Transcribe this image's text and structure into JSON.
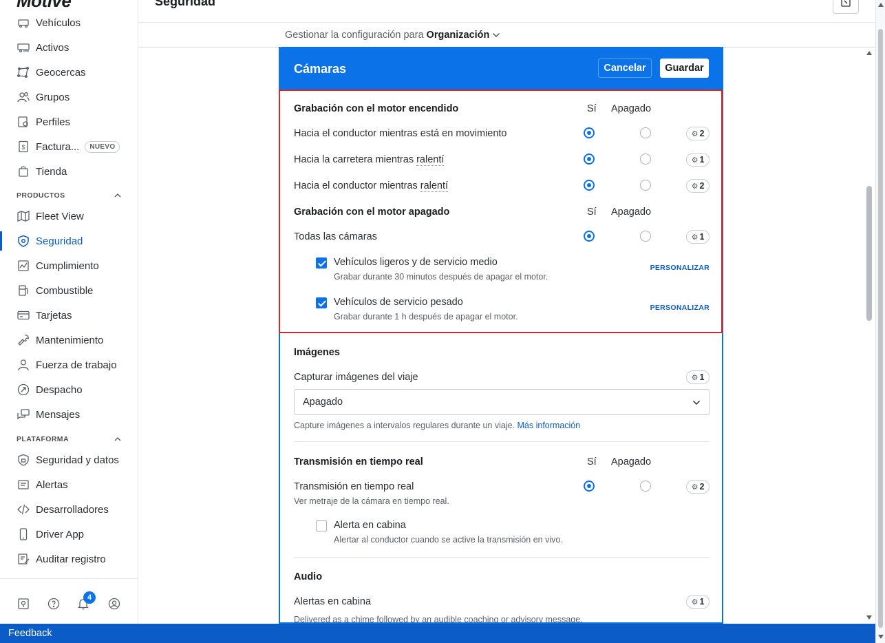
{
  "app": {
    "logo": "Motive",
    "page_title": "Seguridad"
  },
  "config": {
    "prefix": "Gestionar la configuración para",
    "org": "Organización"
  },
  "sidebar": {
    "items_top": [
      {
        "label": "Vehículos",
        "icon": "truck-icon"
      },
      {
        "label": "Activos",
        "icon": "trailer-icon"
      },
      {
        "label": "Geocercas",
        "icon": "geofence-icon"
      },
      {
        "label": "Grupos",
        "icon": "users-icon"
      },
      {
        "label": "Perfiles",
        "icon": "profile-gear-icon"
      },
      {
        "label": "Factura...",
        "icon": "invoice-icon",
        "badge": "NUEVO"
      },
      {
        "label": "Tienda",
        "icon": "shopping-bag-icon"
      }
    ],
    "section_products": "PRODUCTOS",
    "items_products": [
      {
        "label": "Fleet View",
        "icon": "map-icon"
      },
      {
        "label": "Seguridad",
        "icon": "shield-icon",
        "active": true
      },
      {
        "label": "Cumplimiento",
        "icon": "chart-icon"
      },
      {
        "label": "Combustible",
        "icon": "fuel-icon"
      },
      {
        "label": "Tarjetas",
        "icon": "card-icon"
      },
      {
        "label": "Mantenimiento",
        "icon": "wrench-icon"
      },
      {
        "label": "Fuerza de trabajo",
        "icon": "person-icon"
      },
      {
        "label": "Despacho",
        "icon": "dispatch-icon"
      },
      {
        "label": "Mensajes",
        "icon": "messages-icon"
      }
    ],
    "section_platform": "PLATAFORMA",
    "items_platform": [
      {
        "label": "Seguridad y datos",
        "icon": "lock-shield-icon"
      },
      {
        "label": "Alertas",
        "icon": "alert-icon"
      },
      {
        "label": "Desarrolladores",
        "icon": "code-icon"
      },
      {
        "label": "Driver App",
        "icon": "phone-icon"
      },
      {
        "label": "Auditar registro",
        "icon": "audit-icon"
      }
    ],
    "notification_count": "4"
  },
  "card": {
    "title": "Cámaras",
    "cancel_label": "Cancelar",
    "save_label": "Guardar",
    "col_yes": "Sí",
    "col_off": "Apagado",
    "engine_on": {
      "title": "Grabación con el motor encendido",
      "rows": [
        {
          "label": "Hacia el conductor mientras está en movimiento",
          "count": "2"
        },
        {
          "label_a": "Hacia la carretera mientras ",
          "label_b": "ralentí",
          "count": "1"
        },
        {
          "label_a": "Hacia el conductor mientras ",
          "label_b": "ralentí",
          "count": "2"
        }
      ]
    },
    "engine_off": {
      "title": "Grabación con el motor apagado",
      "all_label": "Todas las cámaras",
      "all_count": "1",
      "light": {
        "title": "Vehículos ligeros y de servicio medio",
        "desc": "Grabar durante 30 minutos después de apagar el motor.",
        "action": "PERSONALIZAR"
      },
      "heavy": {
        "title": "Vehículos de servicio pesado",
        "desc": "Grabar durante 1 h después de apagar el motor.",
        "action": "PERSONALIZAR"
      }
    },
    "images": {
      "title": "Imágenes",
      "capture_label": "Capturar imágenes del viaje",
      "capture_count": "1",
      "select_value": "Apagado",
      "help": "Capture imágenes a intervalos regulares durante un viaje.",
      "help_link": "Más información"
    },
    "realtime": {
      "title": "Transmisión en tiempo real",
      "row_label": "Transmisión en tiempo real",
      "row_count": "2",
      "row_desc": "Ver metraje de la cámara en tiempo real.",
      "cabin": {
        "title": "Alerta en cabina",
        "desc": "Alertar al conductor cuando se active la transmisión en vivo."
      }
    },
    "audio": {
      "title": "Audio",
      "alerts_label": "Alertas en cabina",
      "alerts_count": "1",
      "alerts_desc": "Delivered as a chime followed by an audible coaching or advisory message."
    }
  },
  "feedback": "Feedback",
  "colors": {
    "brand_blue": "#0b72e8",
    "highlight_red": "#d32a2a"
  }
}
